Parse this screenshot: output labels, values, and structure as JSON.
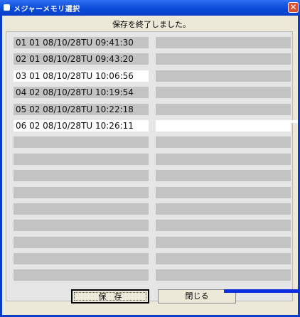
{
  "window": {
    "title": "メジャーメモリ選択",
    "close_glyph": "✕"
  },
  "status_text": "保存を終了しました。",
  "left_slots": [
    {
      "label": "01 01 08/10/28TU 09:41:30",
      "selected": false
    },
    {
      "label": "02 01 08/10/28TU 09:43:20",
      "selected": false
    },
    {
      "label": "03 01 08/10/28TU 10:06:56",
      "selected": true
    },
    {
      "label": "04 02 08/10/28TU 10:19:54",
      "selected": false
    },
    {
      "label": "05 02 08/10/28TU 10:22:18",
      "selected": false
    },
    {
      "label": "06 02 08/10/28TU 10:26:11",
      "selected": true
    },
    {
      "label": "",
      "selected": false
    },
    {
      "label": "",
      "selected": false
    },
    {
      "label": "",
      "selected": false
    },
    {
      "label": "",
      "selected": false
    },
    {
      "label": "",
      "selected": false
    },
    {
      "label": "",
      "selected": false
    },
    {
      "label": "",
      "selected": false
    },
    {
      "label": "",
      "selected": false
    },
    {
      "label": "",
      "selected": false
    }
  ],
  "right_slots": [
    {
      "label": "",
      "selected": false
    },
    {
      "label": "",
      "selected": false
    },
    {
      "label": "",
      "selected": false
    },
    {
      "label": "",
      "selected": false
    },
    {
      "label": "",
      "selected": false
    },
    {
      "label": "",
      "selected": true
    },
    {
      "label": "",
      "selected": false
    },
    {
      "label": "",
      "selected": false
    },
    {
      "label": "",
      "selected": false
    },
    {
      "label": "",
      "selected": false
    },
    {
      "label": "",
      "selected": false
    },
    {
      "label": "",
      "selected": false
    },
    {
      "label": "",
      "selected": false
    },
    {
      "label": "",
      "selected": false
    },
    {
      "label": "",
      "selected": false
    }
  ],
  "buttons": {
    "save_label": "保　存",
    "close_label": "閉じる"
  },
  "colors": {
    "titlebar": "#0a4bd8",
    "client_bg": "#ece9d8",
    "slot_empty": "#c3c3c3",
    "slot_selected": "#ffffff",
    "accent_bar": "#0b2fe0"
  }
}
